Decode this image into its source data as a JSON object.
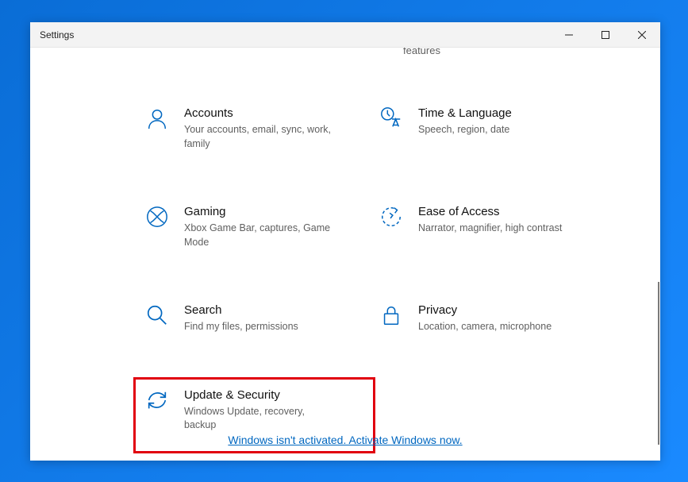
{
  "window": {
    "title": "Settings"
  },
  "partial_top": "features",
  "tiles": {
    "accounts": {
      "title": "Accounts",
      "desc": "Your accounts, email, sync, work, family"
    },
    "time": {
      "title": "Time & Language",
      "desc": "Speech, region, date"
    },
    "gaming": {
      "title": "Gaming",
      "desc": "Xbox Game Bar, captures, Game Mode"
    },
    "ease": {
      "title": "Ease of Access",
      "desc": "Narrator, magnifier, high contrast"
    },
    "search": {
      "title": "Search",
      "desc": "Find my files, permissions"
    },
    "privacy": {
      "title": "Privacy",
      "desc": "Location, camera, microphone"
    },
    "update": {
      "title": "Update & Security",
      "desc": "Windows Update, recovery, backup"
    }
  },
  "activation_link": "Windows isn't activated. Activate Windows now."
}
